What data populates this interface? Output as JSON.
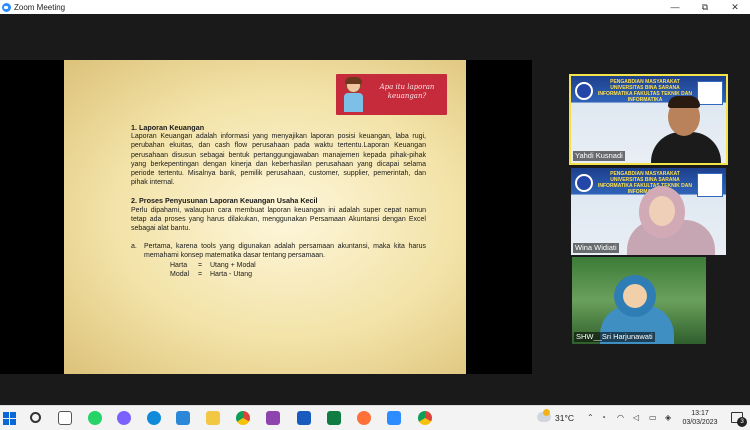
{
  "window": {
    "title": "Zoom Meeting",
    "controls": {
      "minimize": "—",
      "maximize": "⧉",
      "close": "✕"
    }
  },
  "slide": {
    "badge_text": "Apa itu laporan keuangan?",
    "section1_title": "1. Laporan Keuangan",
    "section1_body": "Laporan Keuangan adalah informasi yang menyajikan laporan posisi keuangan, laba rugi, perubahan ekuitas, dan cash flow perusahaan pada waktu tertentu.Laporan Keuangan perusahaan disusun sebagai bentuk pertanggungjawaban manajemen kepada pihak-pihak yang berkepentingan dengan kinerja dan keberhasilan perusahaan yang dicapai selama periode tertentu. Misalnya bank, pemilik perusahaan, customer, supplier, pemerintah, dan pihak internal.",
    "section2_title": "2. Proses Penyusunan Laporan Keuangan Usaha Kecil",
    "section2_body": "Perlu dipahami, walaupun cara membuat laporan keuangan ini adalah super cepat namun tetap ada proses yang harus dilakukan, menggunakan Persamaan Akuntansi dengan Excel sebagai alat bantu.",
    "item_a_marker": "a.",
    "item_a_text": "Pertama, karena tools yang digunakan adalah persamaan akuntansi, maka kita harus memahami konsep matematika dasar tentang persamaan.",
    "eq1": {
      "lhs": "Harta",
      "op": "=",
      "rhs": "Utang + Modal"
    },
    "eq2": {
      "lhs": "Modal",
      "op": "=",
      "rhs": "Harta  -  Utang"
    }
  },
  "participants": [
    {
      "name": "Yahdi Kusnadi",
      "speaking": true
    },
    {
      "name": "Wina Widiati",
      "speaking": false
    },
    {
      "name": "SHW__Sri Harjunawati",
      "speaking": false
    }
  ],
  "banner_text": "PENGABDIAN MASYARAKAT UNIVERSITAS BINA SARANA INFORMATIKA FAKULTAS TEKNIK DAN INFORMATIKA",
  "taskbar": {
    "temperature": "31°C",
    "time": "13:17",
    "date": "03/03/2023",
    "notification_count": "3",
    "colors": {
      "zoom": "#2d8cff",
      "word": "#185abd",
      "excel": "#107c41",
      "windows": "#0a69d6"
    }
  }
}
